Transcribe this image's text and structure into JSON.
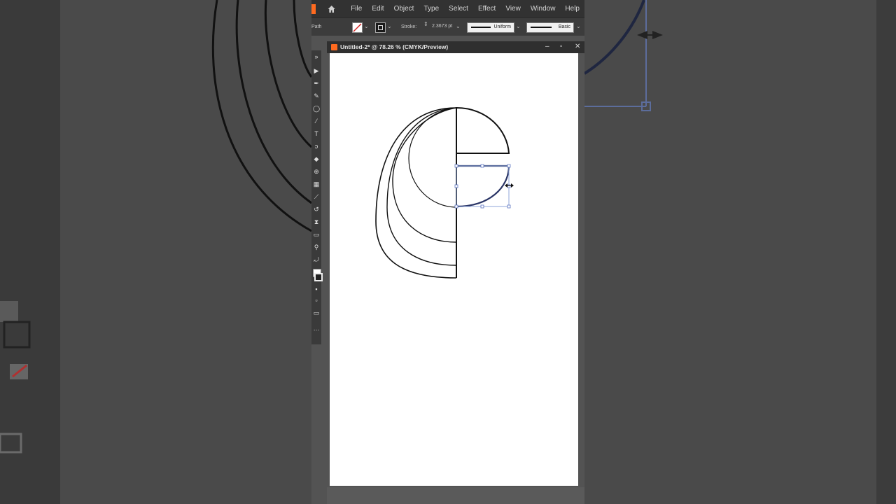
{
  "menubar": {
    "items": [
      "File",
      "Edit",
      "Object",
      "Type",
      "Select",
      "Effect",
      "View",
      "Window",
      "Help"
    ]
  },
  "controlbar": {
    "path_label": "Path",
    "stroke_label": "Stroke:",
    "stroke_value": "2.3673 pt",
    "profile_label": "Uniform",
    "brush_label": "Basic"
  },
  "document": {
    "tab_title": "Untitled-2* @ 78.26 % (CMYK/Preview)"
  },
  "colors": {
    "accent": "#ff6a1f",
    "selection": "#4a5a96",
    "ui_dark": "#323232",
    "artboard": "#ffffff"
  },
  "icons": [
    "home-icon",
    "minimize-icon",
    "maximize-icon",
    "close-icon",
    "resize-cursor-icon"
  ]
}
